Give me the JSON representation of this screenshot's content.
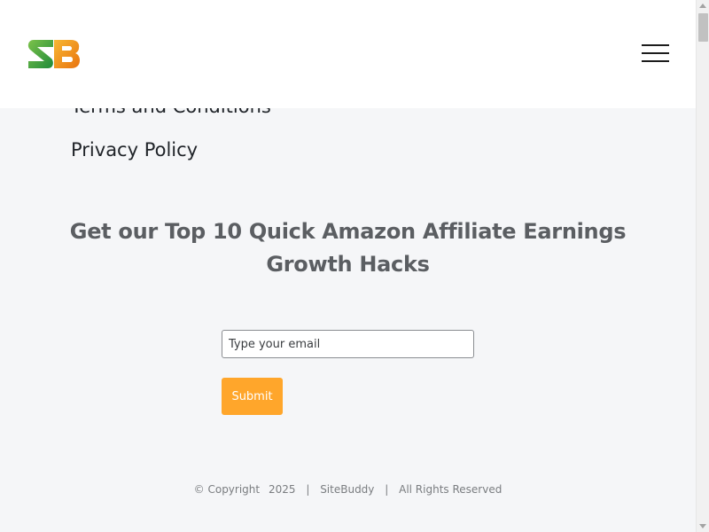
{
  "header": {
    "logo_text": "SB",
    "menu_icon": "hamburger-menu-icon"
  },
  "links": [
    {
      "label": "Terms and Conditions"
    },
    {
      "label": "Privacy Policy"
    }
  ],
  "signup": {
    "headline": "Get our Top 10 Quick Amazon Affiliate Earnings Growth Hacks",
    "email_placeholder": "Type your email",
    "submit_label": "Submit"
  },
  "footer": {
    "copyright": "© Copyright",
    "year": "2025",
    "separator": "|",
    "site_name": "SiteBuddy",
    "rights": "All Rights Reserved"
  },
  "colors": {
    "accent": "#ffa62b",
    "logo_green": "#4caf3c",
    "logo_orange": "#f29a1e",
    "background": "#f5f6f8",
    "heading": "#5b5e62"
  }
}
